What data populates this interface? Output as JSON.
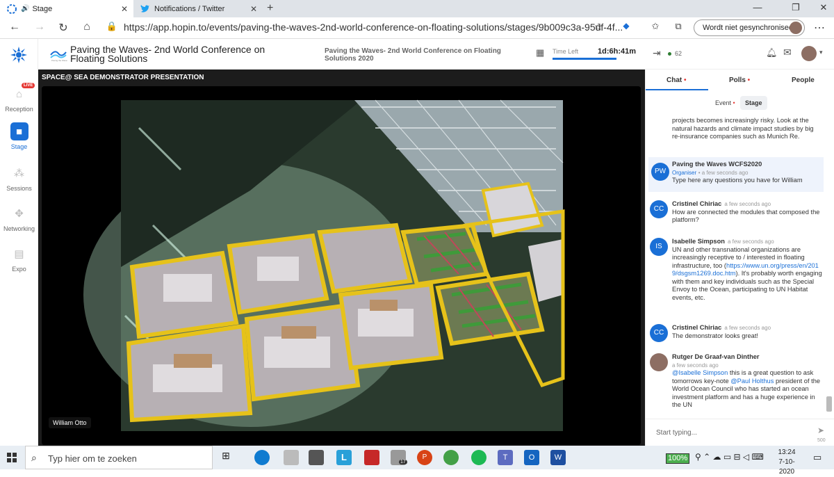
{
  "browser": {
    "tabs": [
      {
        "label": "Stage",
        "icon": "hopin-icon"
      },
      {
        "label": "Notifications / Twitter",
        "icon": "twitter-icon"
      }
    ],
    "url": "https://app.hopin.to/events/paving-the-waves-2nd-world-conference-on-floating-solutions/stages/9b009c3a-95df-4f...",
    "sync_label": "Wordt niet gesynchroniseerd"
  },
  "rail": {
    "items": [
      {
        "label": "Reception",
        "icon": "home-icon"
      },
      {
        "label": "Stage",
        "icon": "camera-icon"
      },
      {
        "label": "Sessions",
        "icon": "people-icon"
      },
      {
        "label": "Networking",
        "icon": "handshake-icon"
      },
      {
        "label": "Expo",
        "icon": "booth-icon"
      }
    ],
    "live_badge": "LIVE"
  },
  "header": {
    "event_title": "Paving the Waves- 2nd World Conference on Floating Solutions",
    "session_title": "Paving the Waves- 2nd World Conference on Floating Solutions 2020",
    "time_left_label": "Time Left",
    "time_left_value": "1d:6h:41m",
    "viewers": "62"
  },
  "stage": {
    "title": "SPACE@ SEA DEMONSTRATOR PRESENTATION",
    "speaker_name": "William Otto"
  },
  "panel": {
    "tabs": [
      "Chat",
      "Polls",
      "People"
    ],
    "subtabs": [
      "Event",
      "Stage"
    ],
    "input_placeholder": "Start typing...",
    "char_count": "500",
    "messages": [
      {
        "text": "projects becomes increasingly risky. Look at the natural hazards and climate impact studies by big re-insurance companies such as Munich Re."
      },
      {
        "initials": "PW",
        "name": "Paving the Waves WCFS2020",
        "role": "Organiser",
        "time": "• a few seconds ago",
        "text": "Type here any questions you have for William"
      },
      {
        "initials": "CC",
        "name": "Cristinel Chiriac",
        "time": "a few seconds ago",
        "text": "How are connected the modules that composed the platform?"
      },
      {
        "initials": "IS",
        "name": "Isabelle Simpson",
        "time": "a few seconds ago",
        "text_before": "UN and other transnational organizations are increasingly receptive to / interested in floating infrastructure, too (",
        "link": "https://www.un.org/press/en/2019/dsgsm1269.doc.htm",
        "text_after": "). It's probably worth engaging with them and key individuals such as the Special Envoy to the Ocean, participating to UN Habitat events, etc."
      },
      {
        "initials": "CC",
        "name": "Cristinel Chiriac",
        "time": "a few seconds ago",
        "text": "The demonstrator looks great!"
      },
      {
        "name": "Rutger De Graaf-van Dinther",
        "time": "a few seconds ago",
        "mention1": "@Isabelle Simpson",
        "text1": " this is a great question to ask tomorrows key-note ",
        "mention2": "@Paul Holthus",
        "text2": " president of the World Ocean Council who has started an ocean investment platform and has a huge experience in the UN"
      }
    ]
  },
  "taskbar": {
    "search_placeholder": "Typ hier om te zoeken",
    "battery": "100%",
    "time": "13:24",
    "date": "7-10-2020",
    "badge_17": "17"
  },
  "colors": {
    "accent": "#1a6fd6",
    "live": "#e53935"
  }
}
